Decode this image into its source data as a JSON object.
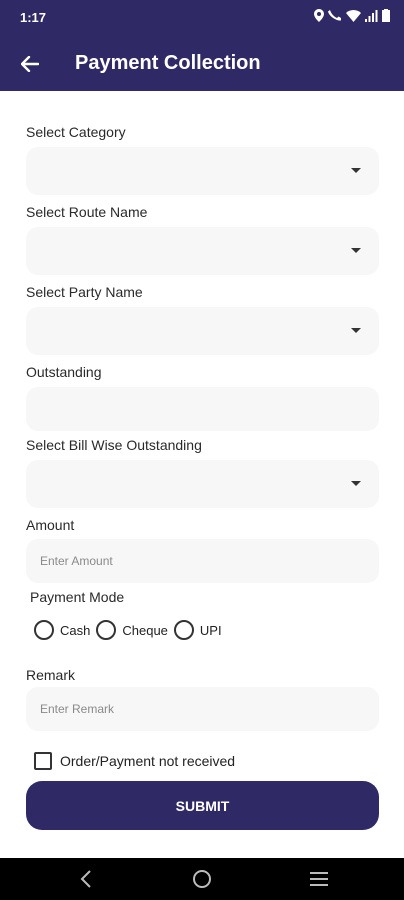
{
  "status_bar": {
    "time": "1:17"
  },
  "header": {
    "title": "Payment Collection"
  },
  "form": {
    "category": {
      "label": "Select Category",
      "value": ""
    },
    "route": {
      "label": "Select Route Name",
      "value": ""
    },
    "party": {
      "label": "Select Party Name",
      "value": ""
    },
    "outstanding": {
      "label": "Outstanding",
      "value": ""
    },
    "bill_wise": {
      "label": "Select Bill Wise Outstanding",
      "value": ""
    },
    "amount": {
      "label": "Amount",
      "placeholder": "Enter Amount"
    },
    "payment_mode": {
      "label": "Payment Mode",
      "options": [
        "Cash",
        "Cheque",
        "UPI"
      ]
    },
    "remark": {
      "label": "Remark",
      "placeholder": "Enter Remark"
    },
    "not_received": {
      "label": "Order/Payment not received",
      "checked": false
    },
    "submit_label": "SUBMIT"
  },
  "theme": {
    "primary": "#2f2a66",
    "field_bg": "#f7f7f7"
  }
}
